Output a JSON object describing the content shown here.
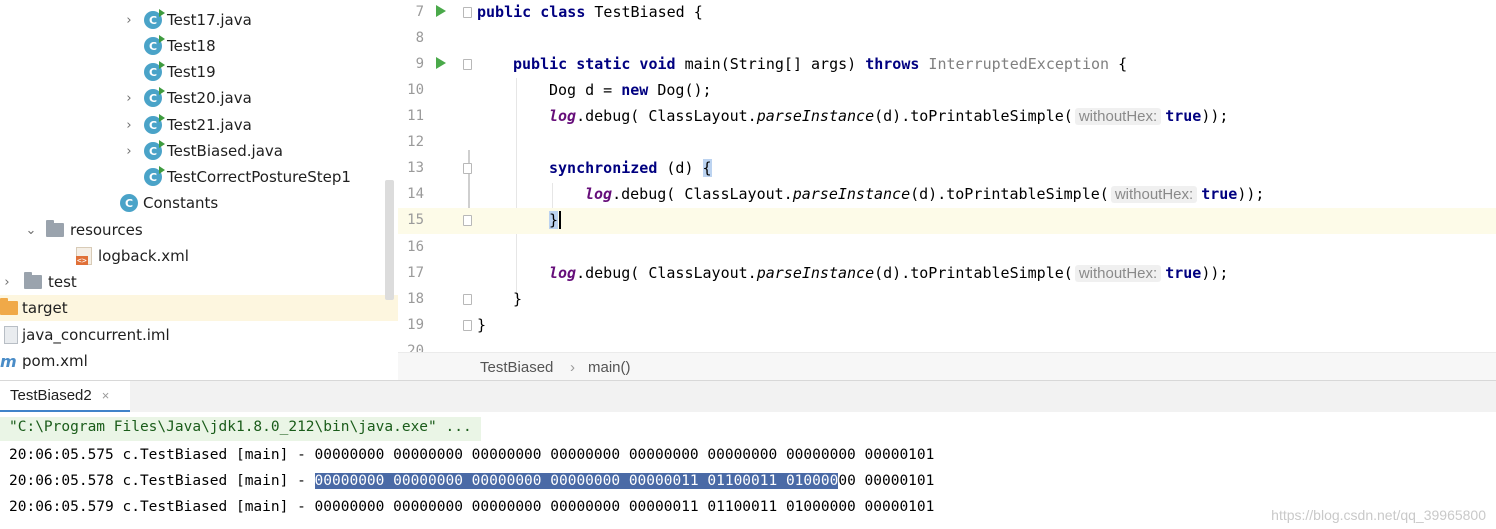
{
  "project_tree": {
    "items": [
      {
        "label": "Test17.java",
        "icon": "class-icon",
        "runnable": true,
        "chevron": true
      },
      {
        "label": "Test18",
        "icon": "class-icon",
        "runnable": true,
        "chevron": false
      },
      {
        "label": "Test19",
        "icon": "class-icon",
        "runnable": true,
        "chevron": false
      },
      {
        "label": "Test20.java",
        "icon": "class-icon",
        "runnable": true,
        "chevron": true
      },
      {
        "label": "Test21.java",
        "icon": "class-icon",
        "runnable": true,
        "chevron": true
      },
      {
        "label": "TestBiased.java",
        "icon": "class-icon",
        "runnable": true,
        "chevron": true
      },
      {
        "label": "TestCorrectPostureStep1",
        "icon": "class-icon",
        "runnable": true,
        "chevron": false
      },
      {
        "label": "Constants",
        "icon": "class-icon",
        "runnable": false,
        "chevron": false
      },
      {
        "label": "resources",
        "icon": "folder-icon",
        "chevron": true
      },
      {
        "label": "logback.xml",
        "icon": "xml-file-icon",
        "chevron": false
      },
      {
        "label": "test",
        "icon": "folder-icon",
        "chevron": true
      },
      {
        "label": "target",
        "icon": "folder-icon",
        "chevron": false
      },
      {
        "label": "java_concurrent.iml",
        "icon": "iml-file-icon",
        "chevron": false
      },
      {
        "label": "pom.xml",
        "icon": "maven-icon",
        "chevron": false
      }
    ],
    "class_glyph": "C"
  },
  "editor": {
    "line_numbers": [
      "7",
      "8",
      "9",
      "10",
      "11",
      "12",
      "13",
      "14",
      "15",
      "16",
      "17",
      "18",
      "19",
      "20"
    ],
    "lines": {
      "l7": {
        "kw1": "public class",
        "rest": " TestBiased {"
      },
      "l9": {
        "kw1": "public static void",
        "mid": " main(String[] args) ",
        "kw2": "throws",
        "exc": " InterruptedException",
        "end": " {"
      },
      "l10": {
        "type": "Dog d = ",
        "kw": "new",
        "rest": " Dog();"
      },
      "l11": {
        "log": "log",
        "a": ".debug( ClassLayout.",
        "method": "parseInstance",
        "b": "(d).toPrintableSimple(",
        "hint": "withoutHex:",
        "kw": "true",
        "end": "));"
      },
      "l13": {
        "kw": "synchronized",
        "a": " (d) ",
        "brace": "{"
      },
      "l14": {
        "log": "log",
        "a": ".debug( ClassLayout.",
        "method": "parseInstance",
        "b": "(d).toPrintableSimple(",
        "hint": "withoutHex:",
        "kw": "true",
        "end": "));"
      },
      "l15": {
        "brace": "}"
      },
      "l17": {
        "log": "log",
        "a": ".debug( ClassLayout.",
        "method": "parseInstance",
        "b": "(d).toPrintableSimple(",
        "hint": "withoutHex:",
        "kw": "true",
        "end": "));"
      },
      "l18": {
        "brace": "}"
      },
      "l19": {
        "brace": "}"
      }
    }
  },
  "breadcrumb": {
    "class_name": "TestBiased",
    "separator": "›",
    "method": "main()"
  },
  "run_panel": {
    "tab_label": "TestBiased2",
    "close_glyph": "×",
    "command": "\"C:\\Program Files\\Java\\jdk1.8.0_212\\bin\\java.exe\" ...",
    "lines": [
      {
        "prefix": "20:06:05.575 c.TestBiased [main] - ",
        "selected": "",
        "rest": "00000000 00000000 00000000 00000000 00000000 00000000 00000000 00000101"
      },
      {
        "prefix": "20:06:05.578 c.TestBiased [main] - ",
        "selected": "00000000 00000000 00000000 00000000 00000011 01100011 010000",
        "rest": "00 00000101"
      },
      {
        "prefix": "20:06:05.579 c.TestBiased [main] - ",
        "selected": "",
        "rest": "00000000 00000000 00000000 00000000 00000011 01100011 01000000 00000101"
      }
    ]
  },
  "watermark": "https://blog.csdn.net/qq_39965800",
  "colors": {
    "keyword": "#000080",
    "log_field": "#660e7a",
    "selection": "#4a6aa6",
    "run_tab_underline": "#4083c9",
    "class_icon": "#4aa3c8"
  }
}
